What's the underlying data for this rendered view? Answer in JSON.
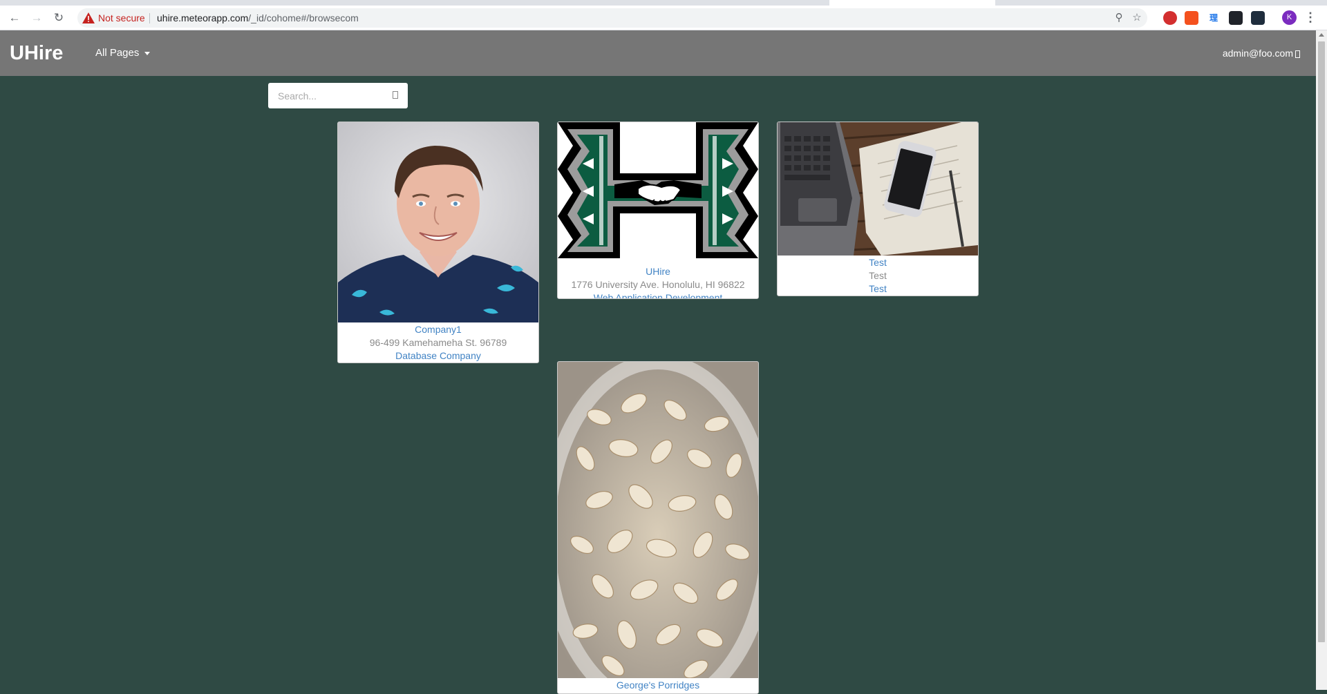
{
  "browser": {
    "security_label": "Not secure",
    "url_host": "uhire.meteorapp.com",
    "url_path": "/_id/cohome#/browsecom",
    "profile_initial": "K",
    "extensions": [
      {
        "name": "adblock-extension",
        "glyph": "",
        "color": "#d32f2f"
      },
      {
        "name": "lock-extension",
        "glyph": "",
        "color": "#f4511e"
      },
      {
        "name": "translate-extension",
        "glyph": "理",
        "color": "#1a73e8"
      },
      {
        "name": "react-devtools-extension",
        "glyph": "",
        "color": "#20232a"
      },
      {
        "name": "extension-icon",
        "glyph": "",
        "color": "#1f2d3d"
      }
    ]
  },
  "navbar": {
    "brand": "UHire",
    "menu_label": "All Pages",
    "user_email": "admin@foo.com"
  },
  "search": {
    "placeholder": "Search..."
  },
  "companies": [
    {
      "name": "Company1",
      "address": "96-499 Kamehameha St. 96789",
      "category": "Database Company",
      "image": "portrait of smiling man in blue floral shirt"
    },
    {
      "name": "UHire",
      "address": "1776 University Ave. Honolulu, HI 96822",
      "category": "Web Application Development",
      "image": "green H logo with handshake"
    },
    {
      "name": "Test",
      "address": "Test",
      "category": "Test",
      "image": "laptop and phone on wooden desk"
    },
    {
      "name": "George's Porridges",
      "address": "",
      "category": "",
      "image": "jar of rolled oats"
    }
  ]
}
